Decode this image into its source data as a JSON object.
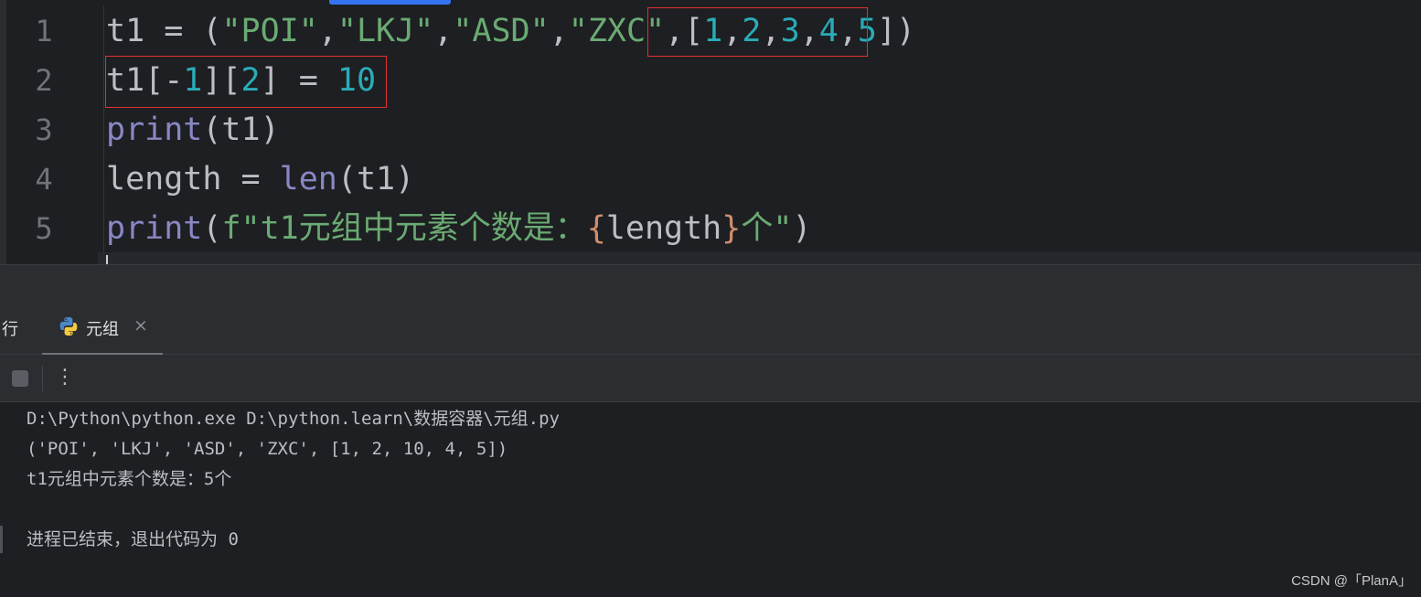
{
  "editor": {
    "line_numbers": [
      "1",
      "2",
      "3",
      "4",
      "5"
    ],
    "lines": [
      {
        "tokens": [
          {
            "t": "t1 = (",
            "c": ""
          },
          {
            "t": "\"POI\"",
            "c": "str"
          },
          {
            "t": ",",
            "c": ""
          },
          {
            "t": "\"LKJ\"",
            "c": "str"
          },
          {
            "t": ",",
            "c": ""
          },
          {
            "t": "\"ASD\"",
            "c": "str"
          },
          {
            "t": ",",
            "c": ""
          },
          {
            "t": "\"ZXC\"",
            "c": "str"
          },
          {
            "t": ",[",
            "c": ""
          },
          {
            "t": "1",
            "c": "num"
          },
          {
            "t": ",",
            "c": ""
          },
          {
            "t": "2",
            "c": "num"
          },
          {
            "t": ",",
            "c": ""
          },
          {
            "t": "3",
            "c": "num"
          },
          {
            "t": ",",
            "c": ""
          },
          {
            "t": "4",
            "c": "num"
          },
          {
            "t": ",",
            "c": ""
          },
          {
            "t": "5",
            "c": "num"
          },
          {
            "t": "])",
            "c": ""
          }
        ]
      },
      {
        "tokens": [
          {
            "t": "t1[-",
            "c": ""
          },
          {
            "t": "1",
            "c": "num"
          },
          {
            "t": "][",
            "c": ""
          },
          {
            "t": "2",
            "c": "num"
          },
          {
            "t": "] = ",
            "c": ""
          },
          {
            "t": "10",
            "c": "num"
          }
        ]
      },
      {
        "tokens": [
          {
            "t": "print",
            "c": "kw-fn"
          },
          {
            "t": "(t1)",
            "c": ""
          }
        ]
      },
      {
        "tokens": [
          {
            "t": "length = ",
            "c": ""
          },
          {
            "t": "len",
            "c": "kw-fn"
          },
          {
            "t": "(t1)",
            "c": ""
          }
        ]
      },
      {
        "tokens": [
          {
            "t": "print",
            "c": "kw-fn"
          },
          {
            "t": "(",
            "c": ""
          },
          {
            "t": "f\"t1元组中元素个数是：",
            "c": "str"
          },
          {
            "t": "{",
            "c": "brace"
          },
          {
            "t": "length",
            "c": ""
          },
          {
            "t": "}",
            "c": "brace"
          },
          {
            "t": "个\"",
            "c": "str"
          },
          {
            "t": ")",
            "c": ""
          }
        ]
      }
    ]
  },
  "run_panel": {
    "title": "行",
    "tab_label": "元组",
    "close_glyph": "×",
    "more_glyph": "⋮"
  },
  "console": {
    "lines": [
      "D:\\Python\\python.exe D:\\python.learn\\数据容器\\元组.py",
      "('POI', 'LKJ', 'ASD', 'ZXC', [1, 2, 10, 4, 5])",
      "t1元组中元素个数是：5个",
      "",
      "进程已结束，退出代码为 0"
    ]
  },
  "watermark": "CSDN @「PlanA」",
  "colors": {
    "background": "#1e1f22",
    "string": "#6aab73",
    "number": "#2aacb8",
    "builtin": "#8888c6",
    "highlight_box": "#e03030"
  }
}
